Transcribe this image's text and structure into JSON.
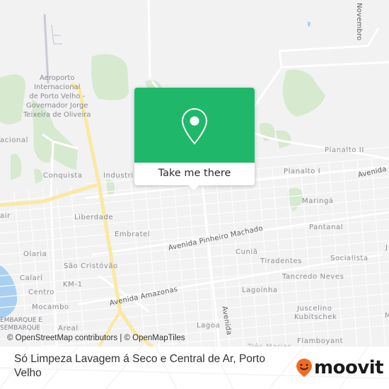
{
  "map": {
    "colors": {
      "background": "#f2f2f3",
      "park": "#d7e9cf",
      "water": "#a9d0f0",
      "highway": "#fbe8a2",
      "road": "#ffffff",
      "runway": "#c9cbd6",
      "label": "#8d8f94"
    },
    "labels": {
      "airport": [
        "Aeroporto",
        "Internacional",
        "de Porto Velho -",
        "Governador Jorge",
        "Teixeira de Oliveira"
      ],
      "nacional": "acional",
      "conquista": "Conquista",
      "industrial": "Industri",
      "planalto_ii": "Planalto II",
      "planalto_i": "Planalto I",
      "maringa": "Maringá",
      "liberdade": "Liberdade",
      "embratel": "Embratel",
      "pantanal": "Pantanal",
      "olaria": "Olaria",
      "cunia": "Cuniã",
      "tiradentes": "Tiradentes",
      "socialista": "Socialista",
      "sao_cristovao": "São Cristóvão",
      "tancredo_neves": "Tancredo Neves",
      "calari": "Calarí",
      "km1": "KM-1",
      "centro": "Centro",
      "lagoinha": "Lagoinha",
      "mocambo": "Mocambo",
      "juscelino": "Juscelino",
      "kubitschek": "Kubitschek",
      "embarque": "EMBARQUE E",
      "desembarque": "SEMBARQUE",
      "areal": "Areal",
      "lagoa": "Lagoa",
      "tres_marias": "Três Marias",
      "flamboyant": "Flamboyant",
      "air": "air",
      "edge_j": "J",
      "edge_m": "M"
    },
    "roads": {
      "novembro": "Novembro",
      "avenida_ne": "Avenida",
      "pinheiro_machado": "Avenida Pinheiro Machado",
      "amazonas": "Avenida Amazonas",
      "avenida_vertical": "Avenida"
    },
    "attribution": "© OpenStreetMap contributors | © OpenMapTiles"
  },
  "popup": {
    "icon": "map-pin-icon",
    "button_label": "Take me there",
    "color": "#1fb86a"
  },
  "footer": {
    "title": "Só Limpeza Lavagem á Seco e Central de Ar, Porto Velho",
    "logo_text": "moovit",
    "logo_icon": "moovit-smile-pin-icon",
    "logo_color": "#f26b21"
  }
}
